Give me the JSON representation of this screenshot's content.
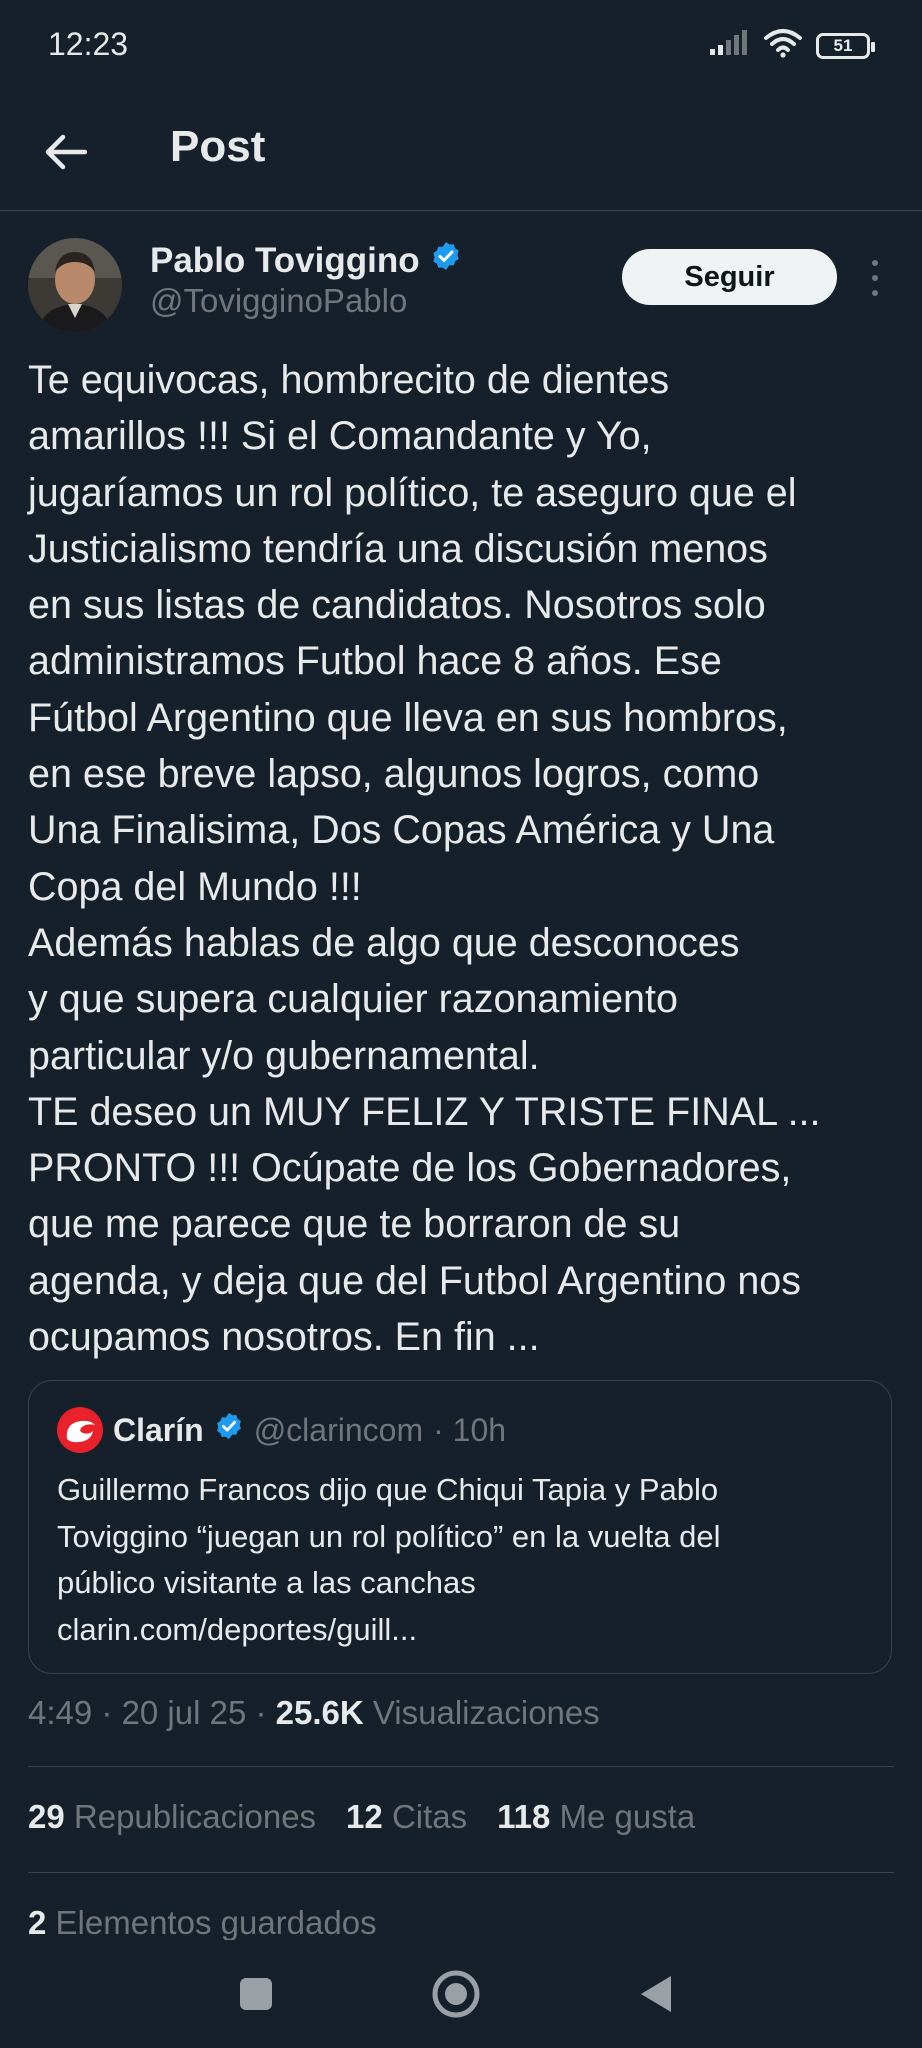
{
  "status_bar": {
    "time": "12:23",
    "battery": "51"
  },
  "header": {
    "title": "Post"
  },
  "author": {
    "name": "Pablo Toviggino",
    "handle": "@TovigginoPablo",
    "follow_label": "Seguir"
  },
  "post": {
    "text": "Te equivocas, hombrecito de dientes\namarillos !!! Si el Comandante y Yo,\njugaríamos un rol político, te aseguro que el\nJusticialismo tendría una discusión menos\nen sus listas de candidatos. Nosotros solo\nadministramos Futbol hace 8 años. Ese\nFútbol Argentino que lleva en sus hombros,\nen ese breve lapso, algunos logros, como\nUna Finalisima, Dos Copas América y Una\nCopa del Mundo !!!\nAdemás hablas de algo que desconoces\ny que supera cualquier razonamiento\nparticular y/o gubernamental.\nTE deseo un MUY FELIZ Y TRISTE FINAL ...\nPRONTO !!! Ocúpate de los Gobernadores,\nque me parece que te borraron de su\nagenda, y deja que del Futbol Argentino nos\nocupamos nosotros. En fin ..."
  },
  "quote": {
    "name": "Clarín",
    "handle": "@clarincom",
    "time": "· 10h",
    "text": "Guillermo Francos dijo que Chiqui Tapia y Pablo\nToviggino “juegan un rol político” en la vuelta del\npúblico visitante a las canchas\nclarin.com/deportes/guill..."
  },
  "meta": {
    "time": "4:49",
    "date": "20 jul 25",
    "views": "25.6K",
    "views_label": "Visualizaciones"
  },
  "stats": {
    "reposts": "29",
    "reposts_label": "Republicaciones",
    "quotes": "12",
    "quotes_label": "Citas",
    "likes": "118",
    "likes_label": "Me gusta",
    "saves": "2",
    "saves_label": "Elementos guardados"
  },
  "colors": {
    "background": "#15202b",
    "text": "#e7e9ea",
    "muted": "#71767b",
    "verified": "#1d9bf0",
    "divider": "#38444d",
    "clarin_red": "#e8212b"
  },
  "icons": [
    "signal-icon",
    "wifi-icon",
    "battery-icon",
    "back-arrow-icon",
    "verified-badge-icon",
    "more-options-icon",
    "clarin-logo-icon",
    "nav-recents-icon",
    "nav-home-icon",
    "nav-back-icon"
  ]
}
